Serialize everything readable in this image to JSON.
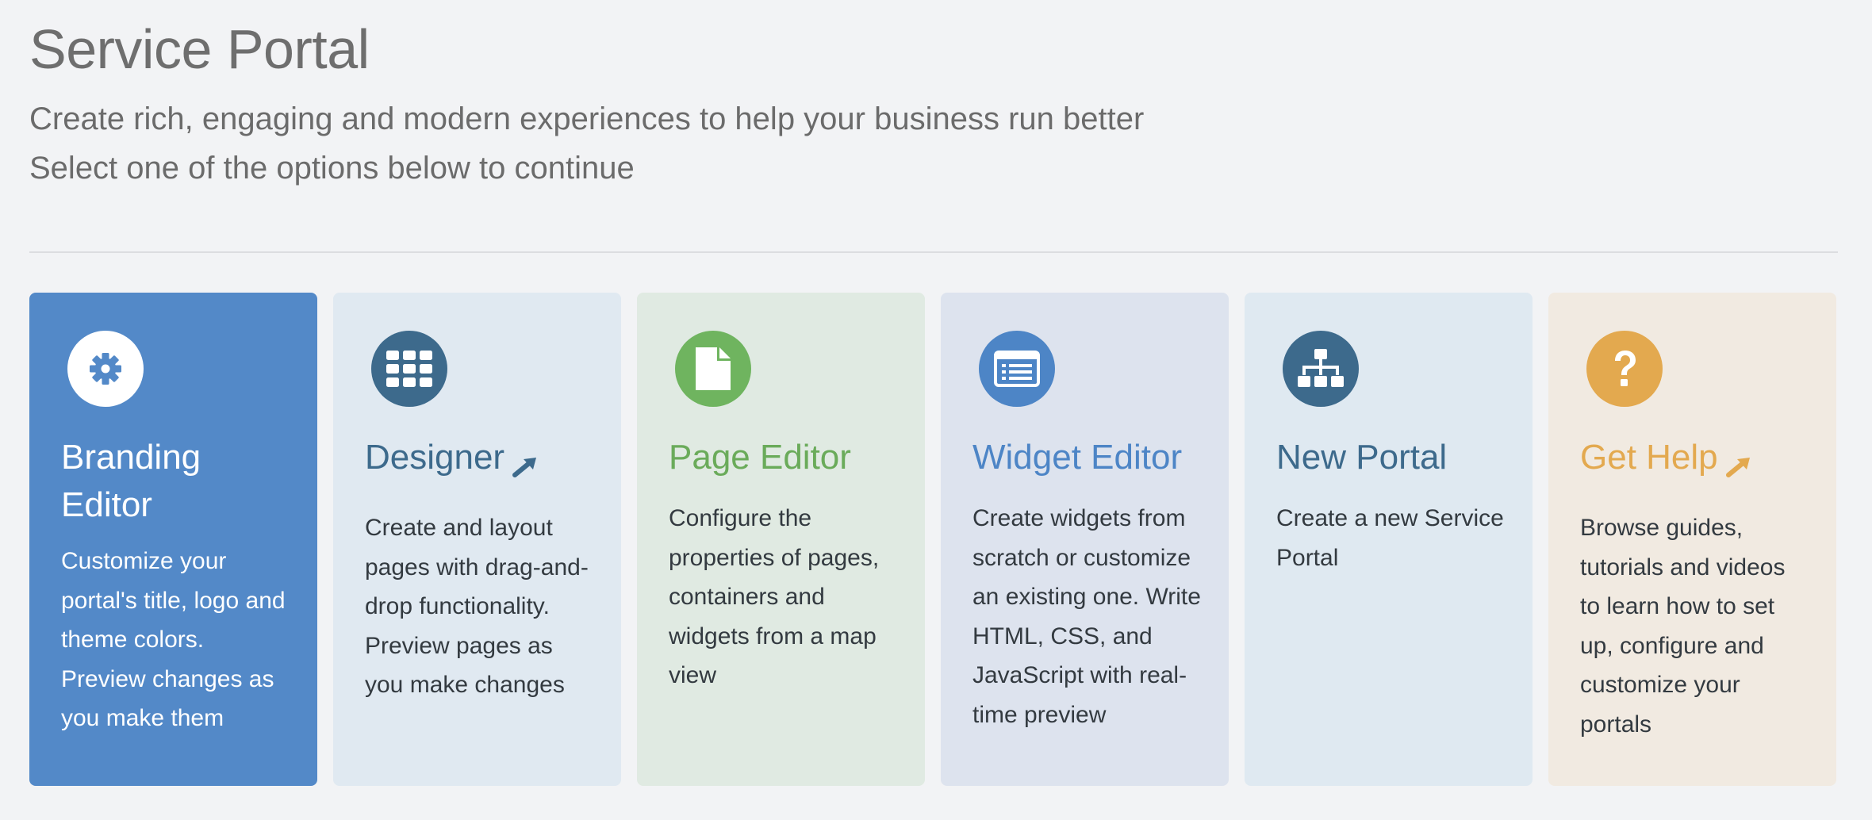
{
  "header": {
    "title": "Service Portal",
    "subtitle_line1": "Create rich, engaging and modern experiences to help your business run better",
    "subtitle_line2": "Select one of the options below to continue"
  },
  "cards": [
    {
      "id": "branding-editor",
      "title": "Branding Editor",
      "description": "Customize your portal's title, logo and theme colors. Preview changes as you make them",
      "icon": "gear-icon",
      "external_link": false,
      "background": "#5389c8",
      "icon_bg": "#ffffff",
      "icon_color": "#5389c8"
    },
    {
      "id": "designer",
      "title": "Designer",
      "description": "Create and layout pages with drag-and-drop functionality. Preview pages as you make changes",
      "icon": "grid-icon",
      "external_link": true,
      "background": "#e0e9f1",
      "icon_bg": "#3d6a8c",
      "icon_color": "#ffffff"
    },
    {
      "id": "page-editor",
      "title": "Page Editor",
      "description": "Configure the properties of pages, containers and widgets from a map view",
      "icon": "file-icon",
      "external_link": false,
      "background": "#e0eae2",
      "icon_bg": "#6fb45f",
      "icon_color": "#ffffff"
    },
    {
      "id": "widget-editor",
      "title": "Widget Editor",
      "description": "Create widgets from scratch or customize an existing one. Write HTML, CSS, and JavaScript with real-time preview",
      "icon": "list-alt-icon",
      "external_link": false,
      "background": "#dde3ee",
      "icon_bg": "#4d85c6",
      "icon_color": "#ffffff"
    },
    {
      "id": "new-portal",
      "title": "New Portal",
      "description": "Create a new Service Portal",
      "icon": "sitemap-icon",
      "external_link": false,
      "background": "#dfe9f1",
      "icon_bg": "#3d6a8c",
      "icon_color": "#ffffff"
    },
    {
      "id": "get-help",
      "title": "Get Help",
      "description": "Browse guides, tutorials and videos to learn how to set up, configure and customize your portals",
      "icon": "question-icon",
      "external_link": true,
      "background": "#f1eae1",
      "icon_bg": "#e3a94f",
      "icon_color": "#ffffff"
    }
  ]
}
